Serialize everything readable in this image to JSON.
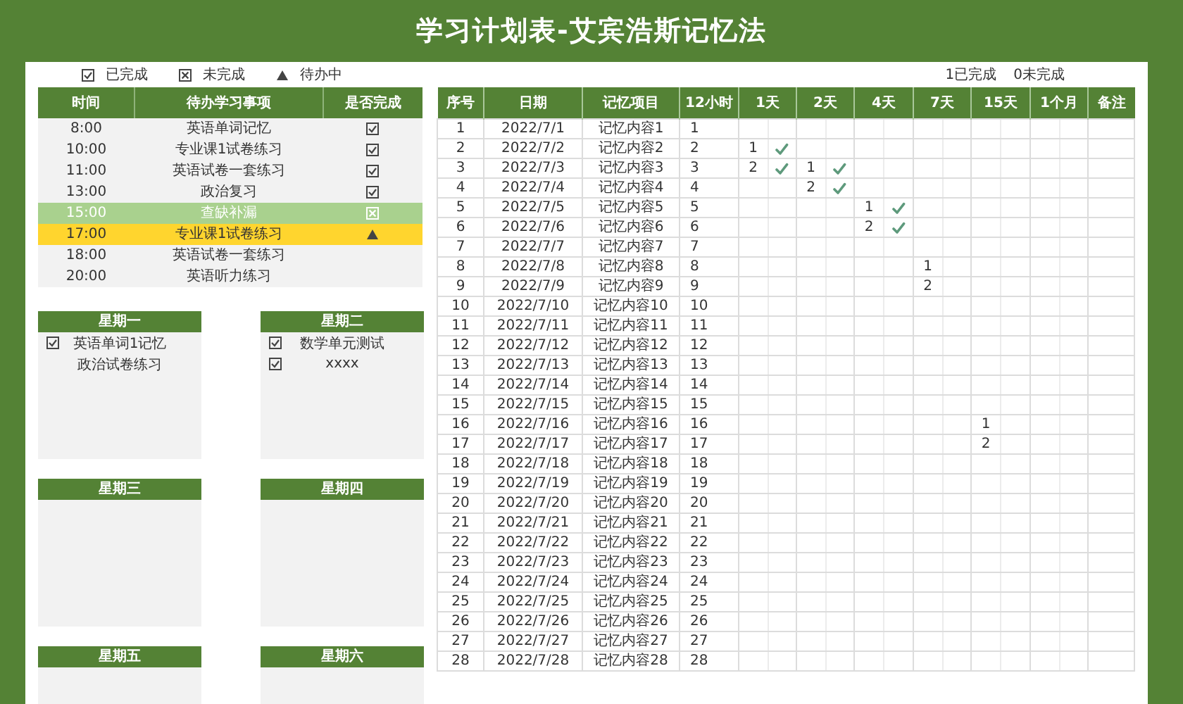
{
  "title": "学习计划表-艾宾浩斯记忆法",
  "legend": [
    {
      "kind": "done",
      "label": "已完成"
    },
    {
      "kind": "missed",
      "label": "未完成"
    },
    {
      "kind": "pending",
      "label": "待办中"
    }
  ],
  "summary": [
    "1已完成",
    "0未完成"
  ],
  "schedule": {
    "columns": [
      "时间",
      "待办学习事项",
      "是否完成"
    ],
    "rows": [
      {
        "time": "8:00",
        "task": "英语单词记忆",
        "kind": "done"
      },
      {
        "time": "10:00",
        "task": "专业课1试卷练习",
        "kind": "done"
      },
      {
        "time": "11:00",
        "task": "英语试卷一套练习",
        "kind": "done"
      },
      {
        "time": "13:00",
        "task": "政治复习",
        "kind": "done"
      },
      {
        "time": "15:00",
        "task": "查缺补漏",
        "kind": "missed"
      },
      {
        "time": "17:00",
        "task": "专业课1试卷练习",
        "kind": "pending"
      },
      {
        "time": "18:00",
        "task": "英语试卷一套练习"
      },
      {
        "time": "20:00",
        "task": "英语听力练习"
      }
    ]
  },
  "week": [
    {
      "day": "星期一",
      "items": [
        {
          "text": "英语单词1记忆",
          "checked": true
        },
        {
          "text": "政治试卷练习",
          "checked": false
        }
      ]
    },
    {
      "day": "星期二",
      "items": [
        {
          "text": "数学单元测试",
          "checked": true
        },
        {
          "text": "xxxx",
          "checked": true
        }
      ]
    },
    {
      "day": "星期三"
    },
    {
      "day": "星期四"
    },
    {
      "day": "星期五"
    },
    {
      "day": "星期六"
    }
  ],
  "memory_table": {
    "columns": [
      "序号",
      "日期",
      "记忆项目",
      "12小时",
      "1天",
      "2天",
      "4天",
      "7天",
      "15天",
      "1个月",
      "备注"
    ],
    "rows": [
      {
        "no": "1",
        "date": "2022/7/1",
        "item": "记忆内容1",
        "h12": "1"
      },
      {
        "no": "2",
        "date": "2022/7/2",
        "item": "记忆内容2",
        "h12": "2",
        "day_1": {
          "count": "1",
          "done": true
        }
      },
      {
        "no": "3",
        "date": "2022/7/3",
        "item": "记忆内容3",
        "h12": "3",
        "day_1": {
          "count": "2",
          "done": true
        },
        "day_2": {
          "count": "1",
          "done": true
        }
      },
      {
        "no": "4",
        "date": "2022/7/4",
        "item": "记忆内容4",
        "h12": "4",
        "day_2": {
          "count": "2",
          "done": true
        }
      },
      {
        "no": "5",
        "date": "2022/7/5",
        "item": "记忆内容5",
        "h12": "5",
        "day_4": {
          "count": "1",
          "done": true
        }
      },
      {
        "no": "6",
        "date": "2022/7/6",
        "item": "记忆内容6",
        "h12": "6",
        "day_4": {
          "count": "2",
          "done": true
        }
      },
      {
        "no": "7",
        "date": "2022/7/7",
        "item": "记忆内容7",
        "h12": "7"
      },
      {
        "no": "8",
        "date": "2022/7/8",
        "item": "记忆内容8",
        "h12": "8",
        "day_7": {
          "count": "1",
          "done": false
        }
      },
      {
        "no": "9",
        "date": "2022/7/9",
        "item": "记忆内容9",
        "h12": "9",
        "day_7": {
          "count": "2",
          "done": false
        }
      },
      {
        "no": "10",
        "date": "2022/7/10",
        "item": "记忆内容10",
        "h12": "10"
      },
      {
        "no": "11",
        "date": "2022/7/11",
        "item": "记忆内容11",
        "h12": "11"
      },
      {
        "no": "12",
        "date": "2022/7/12",
        "item": "记忆内容12",
        "h12": "12"
      },
      {
        "no": "13",
        "date": "2022/7/13",
        "item": "记忆内容13",
        "h12": "13"
      },
      {
        "no": "14",
        "date": "2022/7/14",
        "item": "记忆内容14",
        "h12": "14"
      },
      {
        "no": "15",
        "date": "2022/7/15",
        "item": "记忆内容15",
        "h12": "15"
      },
      {
        "no": "16",
        "date": "2022/7/16",
        "item": "记忆内容16",
        "h12": "16",
        "day_15": {
          "count": "1",
          "done": false
        }
      },
      {
        "no": "17",
        "date": "2022/7/17",
        "item": "记忆内容17",
        "h12": "17",
        "day_15": {
          "count": "2",
          "done": false
        }
      },
      {
        "no": "18",
        "date": "2022/7/18",
        "item": "记忆内容18",
        "h12": "18"
      },
      {
        "no": "19",
        "date": "2022/7/19",
        "item": "记忆内容19",
        "h12": "19"
      },
      {
        "no": "20",
        "date": "2022/7/20",
        "item": "记忆内容20",
        "h12": "20"
      },
      {
        "no": "21",
        "date": "2022/7/21",
        "item": "记忆内容21",
        "h12": "21"
      },
      {
        "no": "22",
        "date": "2022/7/22",
        "item": "记忆内容22",
        "h12": "22"
      },
      {
        "no": "23",
        "date": "2022/7/23",
        "item": "记忆内容23",
        "h12": "23"
      },
      {
        "no": "24",
        "date": "2022/7/24",
        "item": "记忆内容24",
        "h12": "24"
      },
      {
        "no": "25",
        "date": "2022/7/25",
        "item": "记忆内容25",
        "h12": "25"
      },
      {
        "no": "26",
        "date": "2022/7/26",
        "item": "记忆内容26",
        "h12": "26"
      },
      {
        "no": "27",
        "date": "2022/7/27",
        "item": "记忆内容27",
        "h12": "27"
      },
      {
        "no": "28",
        "date": "2022/7/28",
        "item": "记忆内容28",
        "h12": "28"
      }
    ]
  }
}
